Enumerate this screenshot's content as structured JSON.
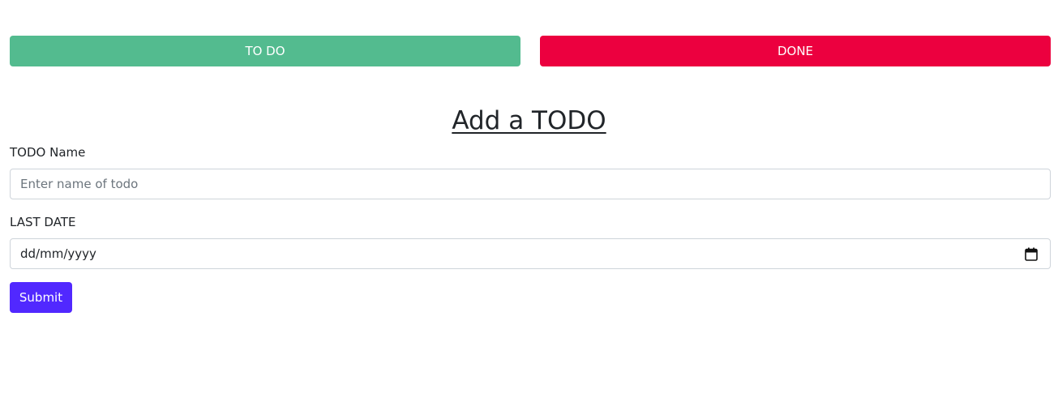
{
  "tabs": {
    "todo_label": "TO DO",
    "done_label": "DONE",
    "todo_color": "#53bb8f",
    "done_color": "#ec003f"
  },
  "form": {
    "title": "Add a TODO",
    "name_label": "TODO Name",
    "name_placeholder": "Enter name of todo",
    "name_value": "",
    "date_label": "LAST DATE",
    "date_placeholder": "dd/mm/yyyy",
    "date_icon": "calendar-icon",
    "submit_label": "Submit",
    "submit_color": "#5128ff"
  }
}
